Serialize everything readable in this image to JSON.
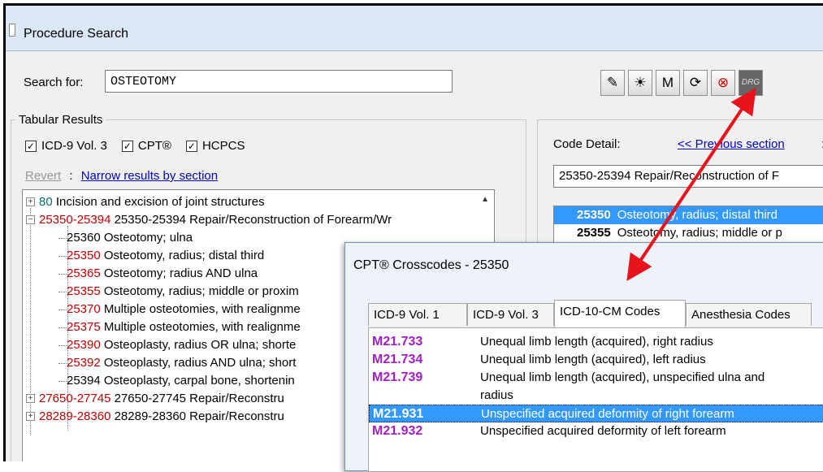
{
  "window": {
    "title": "Procedure Search"
  },
  "search": {
    "label": "Search for:",
    "value": "OSTEOTOMY"
  },
  "toolbar": {
    "buttons": [
      {
        "name": "notes-icon",
        "glyph": "✎"
      },
      {
        "name": "lightbulb-icon",
        "glyph": "☀"
      },
      {
        "name": "m-icon",
        "glyph": "M"
      },
      {
        "name": "refresh-icon",
        "glyph": "⟳"
      },
      {
        "name": "crosscodes-icon",
        "glyph": "⊗"
      },
      {
        "name": "drg-icon",
        "glyph": "DRG"
      }
    ]
  },
  "tabular": {
    "legend": "Tabular Results",
    "checkboxes": [
      {
        "label": "ICD-9 Vol. 3",
        "checked": "✓"
      },
      {
        "label": "CPT®",
        "checked": "✓"
      },
      {
        "label": "HCPCS",
        "checked": "✓"
      }
    ],
    "revert": "Revert",
    "separator": ":",
    "narrow_link": "Narrow results by section"
  },
  "tree": [
    {
      "exp": "+",
      "code": "80",
      "code_color": "teal",
      "text": " Incision and excision of joint structures",
      "level": 0
    },
    {
      "exp": "−",
      "code": "25350-25394",
      "code_color": "red",
      "text": " 25350-25394 Repair/Reconstruction of Forearm/Wr",
      "level": 0
    },
    {
      "code": "",
      "code_color": "red",
      "text": "25360 Osteotomy; ulna",
      "level": 1
    },
    {
      "code": "25350",
      "code_color": "red",
      "text": " Osteotomy, radius; distal third",
      "level": 1
    },
    {
      "code": "25365",
      "code_color": "red",
      "text": " Osteotomy; radius AND ulna",
      "level": 1
    },
    {
      "code": "25355",
      "code_color": "red",
      "text": " Osteotomy, radius; middle or proxim",
      "level": 1
    },
    {
      "code": "25370",
      "code_color": "red",
      "text": " Multiple osteotomies, with realignme",
      "level": 1
    },
    {
      "code": "25375",
      "code_color": "red",
      "text": " Multiple osteotomies, with realignme",
      "level": 1
    },
    {
      "code": "25390",
      "code_color": "red",
      "text": " Osteoplasty, radius OR ulna; shorte",
      "level": 1
    },
    {
      "code": "25392",
      "code_color": "red",
      "text": " Osteoplasty, radius AND ulna; short",
      "level": 1
    },
    {
      "code": "",
      "code_color": "red",
      "text": "25394 Osteoplasty, carpal bone, shortenin",
      "level": 1
    },
    {
      "exp": "+",
      "code": "27650-27745",
      "code_color": "red",
      "text": " 27650-27745 Repair/Reconstru",
      "level": 0
    },
    {
      "exp": "+",
      "code": "28289-28360",
      "code_color": "red",
      "text": " 28289-28360 Repair/Reconstru",
      "level": 0
    }
  ],
  "detail": {
    "label": "Code Detail:",
    "prev_link": "<< Previous section",
    "colon": ":",
    "section": "25350-25394 Repair/Reconstruction of F",
    "rows": [
      {
        "code": "25350",
        "text": "Osteotomy, radius; distal third",
        "selected": true
      },
      {
        "code": "25355",
        "text": "Osteotomy, radius; middle or p",
        "selected": false
      }
    ]
  },
  "crosscodes": {
    "title": "CPT® Crosscodes - 25350",
    "tabs": [
      "ICD-9 Vol. 1",
      "ICD-9 Vol. 3",
      "ICD-10-CM Codes",
      "Anesthesia Codes"
    ],
    "active_tab": "ICD-10-CM Codes",
    "rows": [
      {
        "code": "M21.733",
        "desc": "Unequal limb length (acquired), right radius"
      },
      {
        "code": "M21.734",
        "desc": "Unequal limb length (acquired), left radius"
      },
      {
        "code": "M21.739",
        "desc": "Unequal limb length (acquired), unspecified ulna and"
      },
      {
        "code": "",
        "desc": "radius"
      },
      {
        "code": "M21.931",
        "desc": "Unspecified acquired deformity of right forearm",
        "selected": true
      },
      {
        "code": "M21.932",
        "desc": "Unspecified acquired deformity of left forearm"
      }
    ]
  },
  "colors": {
    "arrow": "#e8131b",
    "selection": "#3399ff",
    "code_purple": "#a020c0",
    "code_red": "#c00000",
    "code_teal": "#007070",
    "link": "#0000cc"
  }
}
